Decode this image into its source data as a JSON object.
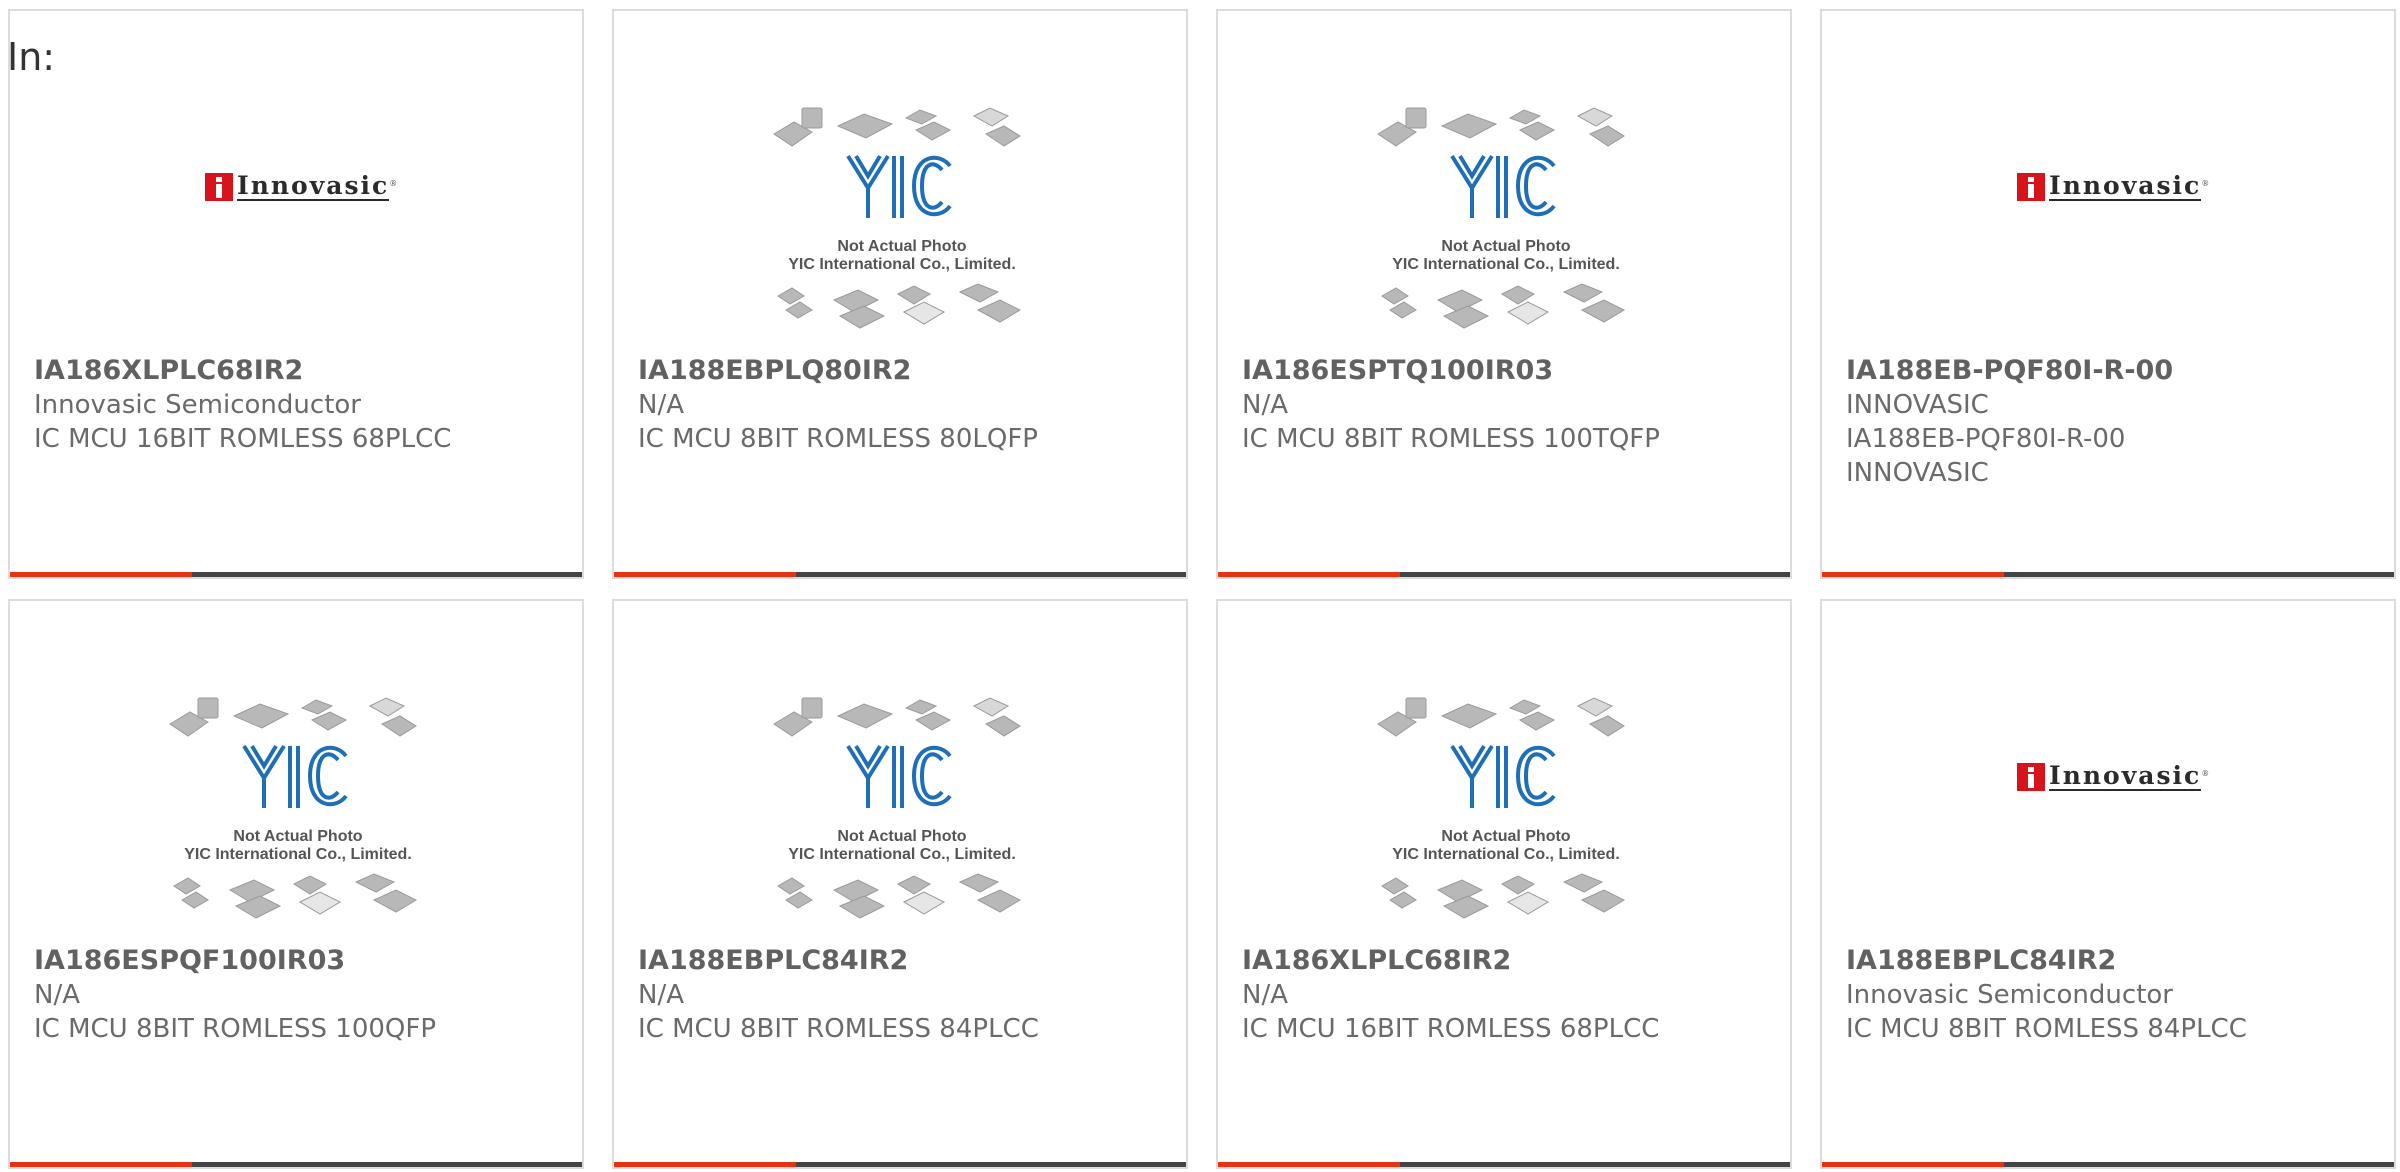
{
  "page": {
    "label": "In:"
  },
  "placeholder_image": {
    "caption_line1": "Not Actual Photo",
    "caption_line2": "YIC International Co., Limited.",
    "logo_text": "YIC"
  },
  "brand_logo": {
    "text": "Innovasic",
    "mark": "i"
  },
  "products": [
    {
      "part_number": "IA186XLPLC68IR2",
      "manufacturer": "Innovasic Semiconductor",
      "description": "IC MCU 16BIT ROMLESS 68PLCC",
      "extra": "",
      "image": "innovasic-logo"
    },
    {
      "part_number": "IA188EBPLQ80IR2",
      "manufacturer": "N/A",
      "description": "IC MCU 8BIT ROMLESS 80LQFP",
      "extra": "",
      "image": "yic-placeholder"
    },
    {
      "part_number": "IA186ESPTQ100IR03",
      "manufacturer": "N/A",
      "description": "IC MCU 8BIT ROMLESS 100TQFP",
      "extra": "",
      "image": "yic-placeholder"
    },
    {
      "part_number": "IA188EB-PQF80I-R-00",
      "manufacturer": "INNOVASIC",
      "description": "IA188EB-PQF80I-R-00",
      "extra": "INNOVASIC",
      "image": "innovasic-logo"
    },
    {
      "part_number": "IA186ESPQF100IR03",
      "manufacturer": "N/A",
      "description": "IC MCU 8BIT ROMLESS 100QFP",
      "extra": "",
      "image": "yic-placeholder"
    },
    {
      "part_number": "IA188EBPLC84IR2",
      "manufacturer": "N/A",
      "description": "IC MCU 8BIT ROMLESS 84PLCC",
      "extra": "",
      "image": "yic-placeholder"
    },
    {
      "part_number": "IA186XLPLC68IR2",
      "manufacturer": "N/A",
      "description": "IC MCU 16BIT ROMLESS 68PLCC",
      "extra": "",
      "image": "yic-placeholder"
    },
    {
      "part_number": "IA188EBPLC84IR2",
      "manufacturer": "Innovasic Semiconductor",
      "description": "IC MCU 8BIT ROMLESS 84PLCC",
      "extra": "",
      "image": "innovasic-logo"
    }
  ],
  "colors": {
    "accent": "#e63312",
    "bar": "#444444",
    "border": "#dcdcdc",
    "text": "#6a6a6a"
  }
}
